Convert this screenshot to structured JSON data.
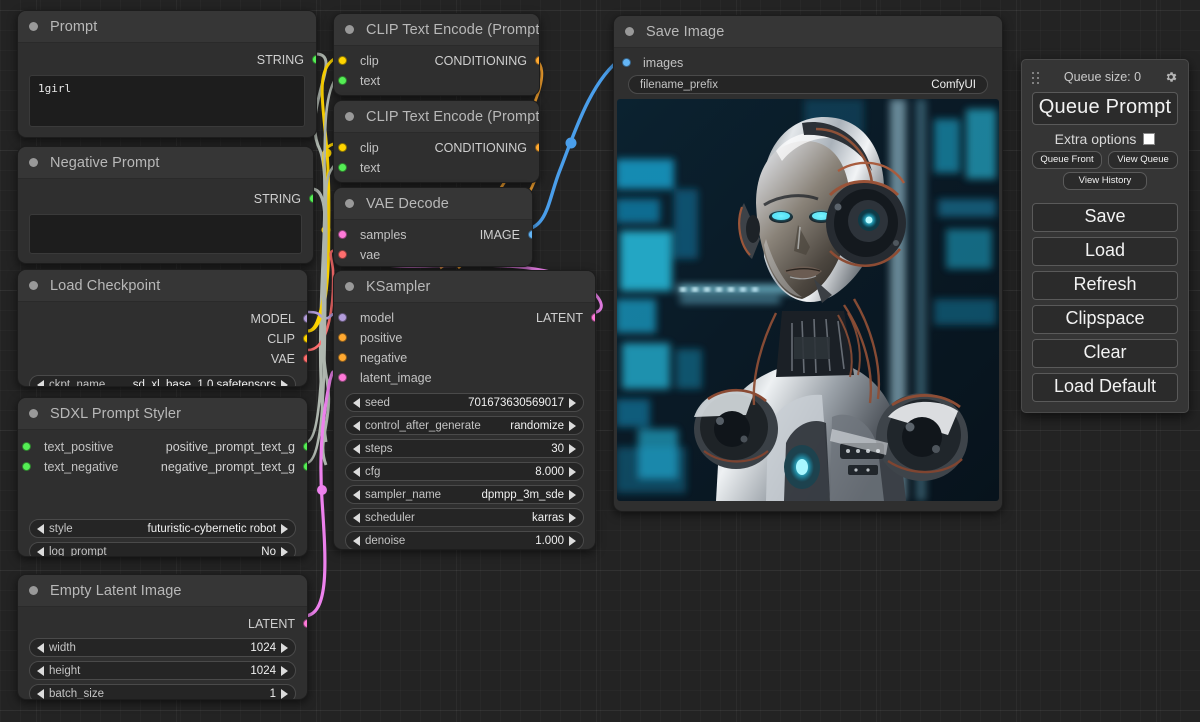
{
  "app": {
    "name": "ComfyUI"
  },
  "nodes": {
    "prompt": {
      "title": "Prompt",
      "outputs": [
        {
          "label": "STRING",
          "color": "#55ee55"
        }
      ],
      "text_value": "1girl"
    },
    "negative_prompt": {
      "title": "Negative Prompt",
      "outputs": [
        {
          "label": "STRING",
          "color": "#55ee55"
        }
      ],
      "text_value": ""
    },
    "load_checkpoint": {
      "title": "Load Checkpoint",
      "outputs": [
        {
          "label": "MODEL",
          "color": "#b39ddb"
        },
        {
          "label": "CLIP",
          "color": "#ffd500"
        },
        {
          "label": "VAE",
          "color": "#ff6e6e"
        }
      ],
      "widgets": [
        {
          "name": "ckpt_name",
          "value": "sd_xl_base_1.0.safetensors"
        }
      ]
    },
    "sdxl_prompt_styler": {
      "title": "SDXL Prompt Styler",
      "inputs": [
        {
          "label": "text_positive",
          "color": "#55ee55"
        },
        {
          "label": "text_negative",
          "color": "#55ee55"
        }
      ],
      "outputs": [
        {
          "label": "positive_prompt_text_g",
          "color": "#55ee55"
        },
        {
          "label": "negative_prompt_text_g",
          "color": "#55ee55"
        }
      ],
      "widgets": [
        {
          "name": "style",
          "value": "futuristic-cybernetic robot"
        },
        {
          "name": "log_prompt",
          "value": "No"
        }
      ]
    },
    "empty_latent_image": {
      "title": "Empty Latent Image",
      "outputs": [
        {
          "label": "LATENT",
          "color": "#ff7ad9"
        }
      ],
      "widgets": [
        {
          "name": "width",
          "value": "1024"
        },
        {
          "name": "height",
          "value": "1024"
        },
        {
          "name": "batch_size",
          "value": "1"
        }
      ]
    },
    "clip_text_encode_positive": {
      "title": "CLIP Text Encode (Prompt)",
      "inputs": [
        {
          "label": "clip",
          "color": "#ffd500"
        },
        {
          "label": "text",
          "color": "#55ee55"
        }
      ],
      "outputs": [
        {
          "label": "CONDITIONING",
          "color": "#ffa931"
        }
      ]
    },
    "clip_text_encode_negative": {
      "title": "CLIP Text Encode (Prompt)",
      "inputs": [
        {
          "label": "clip",
          "color": "#ffd500"
        },
        {
          "label": "text",
          "color": "#55ee55"
        }
      ],
      "outputs": [
        {
          "label": "CONDITIONING",
          "color": "#ffa931"
        }
      ]
    },
    "vae_decode": {
      "title": "VAE Decode",
      "inputs": [
        {
          "label": "samples",
          "color": "#ff7ad9"
        },
        {
          "label": "vae",
          "color": "#ff6e6e"
        }
      ],
      "outputs": [
        {
          "label": "IMAGE",
          "color": "#64b5f6"
        }
      ]
    },
    "ksampler": {
      "title": "KSampler",
      "inputs": [
        {
          "label": "model",
          "color": "#b39ddb"
        },
        {
          "label": "positive",
          "color": "#ffa931"
        },
        {
          "label": "negative",
          "color": "#ffa931"
        },
        {
          "label": "latent_image",
          "color": "#ff7ad9"
        }
      ],
      "outputs": [
        {
          "label": "LATENT",
          "color": "#ff7ad9"
        }
      ],
      "widgets": [
        {
          "name": "seed",
          "value": "701673630569017"
        },
        {
          "name": "control_after_generate",
          "value": "randomize"
        },
        {
          "name": "steps",
          "value": "30"
        },
        {
          "name": "cfg",
          "value": "8.000"
        },
        {
          "name": "sampler_name",
          "value": "dpmpp_3m_sde"
        },
        {
          "name": "scheduler",
          "value": "karras"
        },
        {
          "name": "denoise",
          "value": "1.000"
        }
      ]
    },
    "save_image": {
      "title": "Save Image",
      "inputs": [
        {
          "label": "images",
          "color": "#64b5f6"
        }
      ],
      "widgets": [
        {
          "name": "filename_prefix",
          "value": "ComfyUI"
        }
      ],
      "preview_alt": "Generated image: futuristic cybernetic female robot with chrome head and glowing cyan eyes against a blue data-screen background"
    }
  },
  "menu": {
    "queue_size_label": "Queue size: 0",
    "gear_icon": "gear-icon",
    "grip_icon": "grip-icon",
    "queue_prompt_label": "Queue Prompt",
    "extra_options_label": "Extra options",
    "queue_front_label": "Queue Front",
    "view_queue_label": "View Queue",
    "view_history_label": "View History",
    "save_label": "Save",
    "load_label": "Load",
    "refresh_label": "Refresh",
    "clipspace_label": "Clipspace",
    "clear_label": "Clear",
    "load_default_label": "Load Default"
  },
  "colors": {
    "canvas_bg": "#232323",
    "node_bg": "#2f2f2f",
    "node_header": "#363636",
    "wire_string": "#b0b8b0",
    "wire_clip": "#ffd500",
    "wire_conditioning": "#ffa931",
    "wire_latent": "#ff7ad9",
    "wire_image": "#4a9eea",
    "wire_model": "#b39ddb",
    "wire_vae": "#ff6e6e"
  }
}
